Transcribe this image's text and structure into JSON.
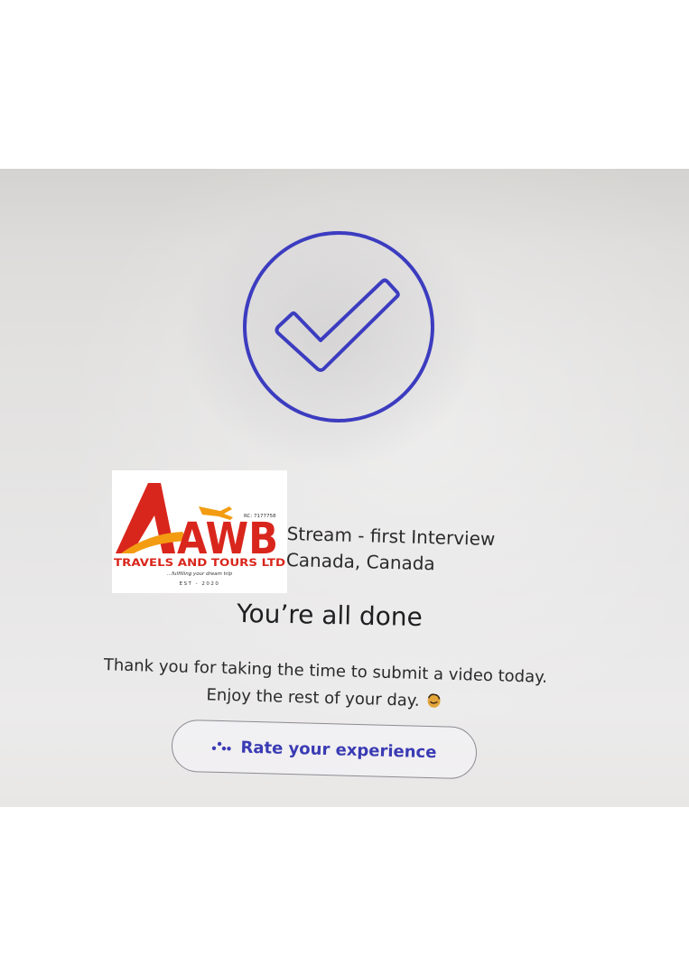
{
  "logo": {
    "letters": "AWB",
    "company": "TRAVELS AND TOURS LTD",
    "tagline": "...fulfilling your dream trip",
    "rc": "RC: 7177758",
    "est": "EST - 2020"
  },
  "interview": {
    "line1": "Stream - first Interview",
    "line2": "Canada, Canada"
  },
  "completion": {
    "title": "You’re all done",
    "message_line1": "Thank you for taking the time to submit a video today.",
    "message_line2": "Enjoy the rest of your day."
  },
  "rate_button": {
    "label": "Rate your experience",
    "icon": "sparkle-dots-icon"
  },
  "colors": {
    "accent": "#3c3cc0",
    "logo_red": "#d9261c",
    "logo_orange": "#f39c12"
  }
}
